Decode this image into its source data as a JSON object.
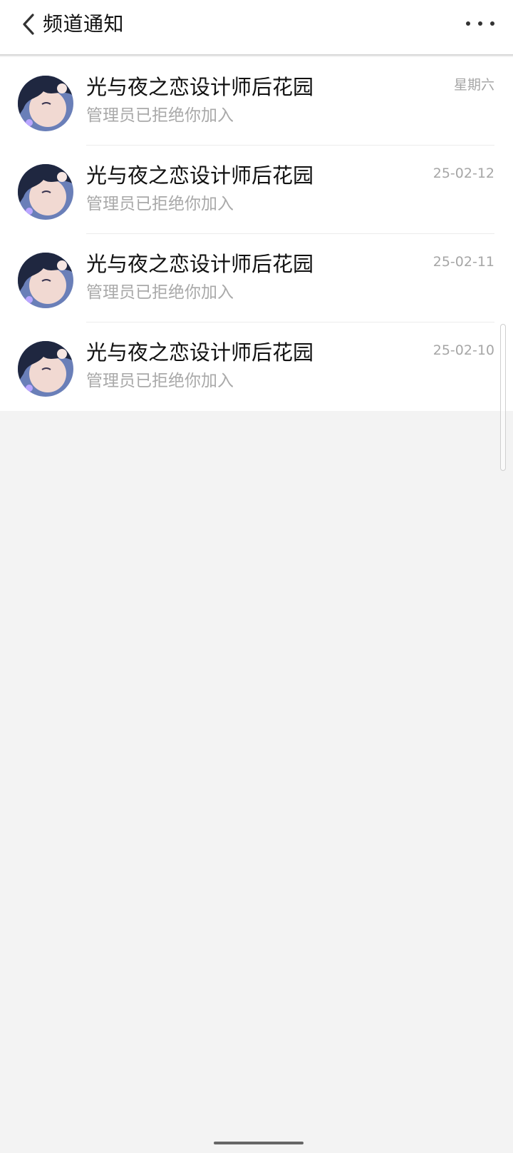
{
  "header": {
    "back_icon": "chevron-left-icon",
    "title": "频道通知",
    "more_icon": "more-horizontal-icon"
  },
  "notifications": [
    {
      "title": "光与夜之恋设计师后花园",
      "subtitle": "管理员已拒绝你加入",
      "date": "星期六"
    },
    {
      "title": "光与夜之恋设计师后花园",
      "subtitle": "管理员已拒绝你加入",
      "date": "25-02-12"
    },
    {
      "title": "光与夜之恋设计师后花园",
      "subtitle": "管理员已拒绝你加入",
      "date": "25-02-11"
    },
    {
      "title": "光与夜之恋设计师后花园",
      "subtitle": "管理员已拒绝你加入",
      "date": "25-02-10"
    }
  ],
  "colors": {
    "background": "#f3f3f3",
    "title_text": "#111111",
    "secondary_text": "#a9a9a9"
  }
}
